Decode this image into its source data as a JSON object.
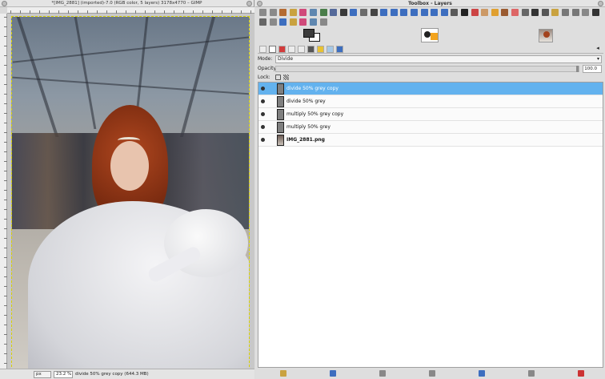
{
  "image_window": {
    "title": "*[IMG_2881] (imported)-7.0 (RGB color, 5 layers) 3178x4770 – GIMP",
    "unit": "px",
    "zoom": "23.2 %",
    "status": "divide 50% grey copy (644.3 MB)"
  },
  "toolbox": {
    "title": "Toolbox - Layers",
    "tool_icons": [
      "rect-select",
      "ellipse-select",
      "free-select",
      "fuzzy-select",
      "color-select",
      "scissors",
      "foreground-select",
      "paths",
      "color-picker",
      "zoom",
      "measure",
      "move",
      "align",
      "crop",
      "rotate",
      "scale",
      "shear",
      "perspective",
      "flip",
      "cage",
      "text",
      "bucket-fill",
      "gradient",
      "pencil",
      "paintbrush",
      "eraser",
      "airbrush",
      "ink",
      "clone",
      "heal",
      "perspective-clone",
      "blur",
      "smudge",
      "dodge-burn"
    ],
    "colors": {
      "foreground": "#3c3c3c",
      "background": "#ffffff",
      "accent_selected": "#63b2ee"
    }
  },
  "layers_panel": {
    "mode_label": "Mode:",
    "mode_value": "Divide",
    "opacity_label": "Opacity:",
    "opacity_value": "100.0",
    "opacity_fraction": 1.0,
    "lock_label": "Lock:",
    "layers": [
      {
        "name": "divide 50% grey copy",
        "selected": true,
        "visible": true,
        "thumb": "grey"
      },
      {
        "name": "divide 50% grey",
        "selected": false,
        "visible": true,
        "thumb": "grey"
      },
      {
        "name": "multiply 50% grey copy",
        "selected": false,
        "visible": true,
        "thumb": "grey"
      },
      {
        "name": "multiply 50% grey",
        "selected": false,
        "visible": true,
        "thumb": "grey"
      },
      {
        "name": "IMG_2881.png",
        "selected": false,
        "visible": true,
        "thumb": "image",
        "bold": true
      }
    ],
    "bottom_buttons": [
      "new-layer",
      "new-layer-group",
      "raise-layer",
      "lower-layer",
      "duplicate-layer",
      "anchor-layer",
      "delete-layer"
    ]
  }
}
